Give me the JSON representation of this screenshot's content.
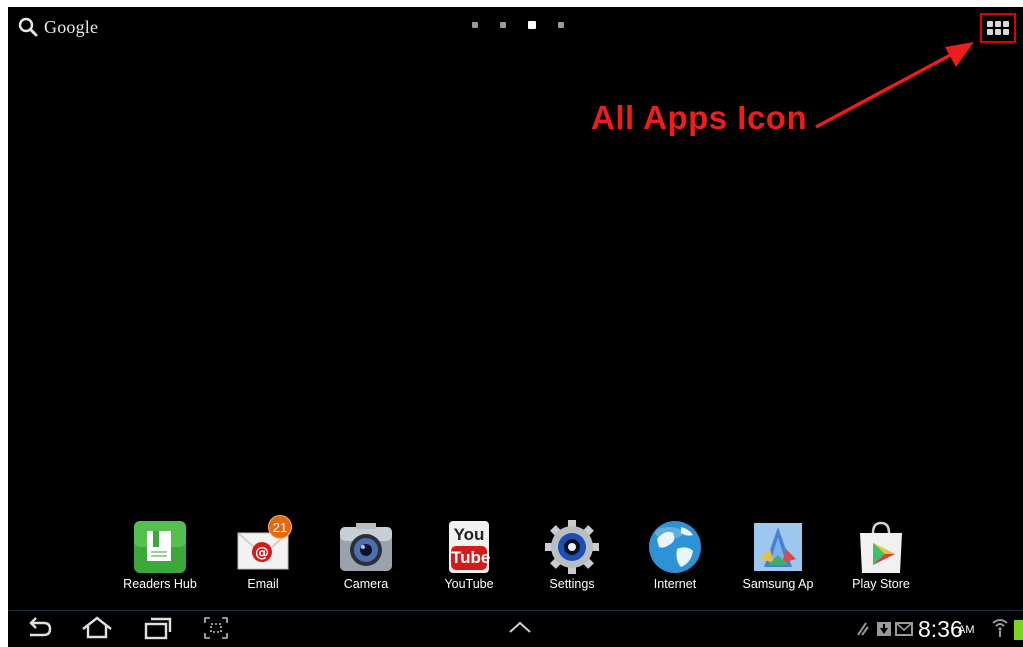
{
  "search": {
    "label": "Google"
  },
  "home_pages": {
    "count": 4,
    "active_index": 2
  },
  "annotation": {
    "text": "All Apps Icon",
    "color": "#ee1c1c"
  },
  "dock": {
    "apps": [
      {
        "label": "Readers Hub",
        "icon": "readers-hub-icon"
      },
      {
        "label": "Email",
        "icon": "email-icon",
        "badge": "21"
      },
      {
        "label": "Camera",
        "icon": "camera-icon"
      },
      {
        "label": "YouTube",
        "icon": "youtube-icon",
        "icon_text_top": "You",
        "icon_text_bottom": "Tube"
      },
      {
        "label": "Settings",
        "icon": "settings-gear-icon"
      },
      {
        "label": "Internet",
        "icon": "globe-icon"
      },
      {
        "label": "Samsung Ap",
        "icon": "samsung-apps-icon"
      },
      {
        "label": "Play Store",
        "icon": "play-store-icon"
      }
    ]
  },
  "status": {
    "time": "8:36",
    "ampm": "AM"
  },
  "colors": {
    "background": "#000000",
    "highlight": "#e00000",
    "battery": "#7dd321"
  }
}
